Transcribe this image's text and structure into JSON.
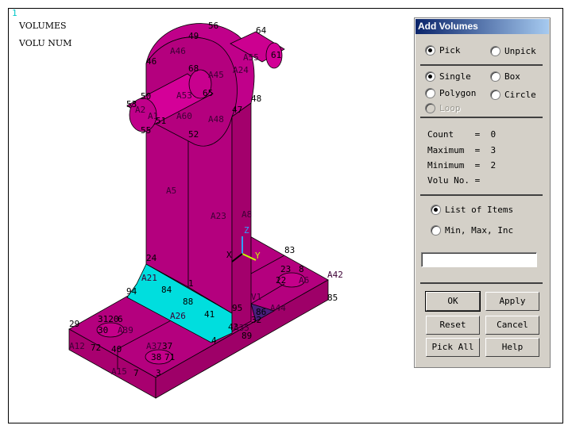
{
  "window_number": "1",
  "legend": {
    "line1": "VOLUMES",
    "line2": "VOLU NUM"
  },
  "colors": {
    "volume": "#b4007e",
    "selected_area": "#00dede",
    "accent_dark": "#4b1e7e",
    "title_bar": "#0a246a"
  },
  "model_labels": [
    "56",
    "64",
    "49",
    "A46",
    "61",
    "A55",
    "46",
    "68",
    "A45",
    "A24",
    "50",
    "A53",
    "65",
    "48",
    "53",
    "A2",
    "A1",
    "51",
    "A60",
    "A48",
    "47",
    "55",
    "52",
    "A5",
    "A23",
    "A8",
    "70",
    "83",
    "24",
    "23",
    "8",
    "A42",
    "A21",
    "22",
    "A6",
    "84",
    "1",
    "85",
    "94",
    "V1",
    "88",
    "95",
    "A44",
    "86",
    "A26",
    "41",
    "32",
    "3120",
    "6",
    "29",
    "30",
    "A39",
    "43",
    "A35",
    "89",
    "4",
    "A12",
    "72",
    "40",
    "A37",
    "37",
    "38",
    "71",
    "A15",
    "7",
    "3"
  ],
  "axes": {
    "x": "X",
    "y": "Y",
    "z": "Z"
  },
  "dialog": {
    "title": "Add Volumes",
    "pick": "Pick",
    "unpick": "Unpick",
    "pick_selected": "Pick",
    "single": "Single",
    "box": "Box",
    "polygon": "Polygon",
    "circle": "Circle",
    "loop": "Loop",
    "mode_selected": "Single",
    "count_label": "Count    =  ",
    "count": "0",
    "maximum_label": "Maximum  =  ",
    "maximum": "3",
    "minimum_label": "Minimum  =  ",
    "minimum": "2",
    "volu_label": "Volu No. =",
    "list_of_items": "List of Items",
    "min_max_inc": "Min, Max, Inc",
    "entry_selected": "List of Items",
    "input_value": "",
    "buttons": {
      "ok": "OK",
      "apply": "Apply",
      "reset": "Reset",
      "cancel": "Cancel",
      "pick_all": "Pick All",
      "help": "Help"
    }
  }
}
